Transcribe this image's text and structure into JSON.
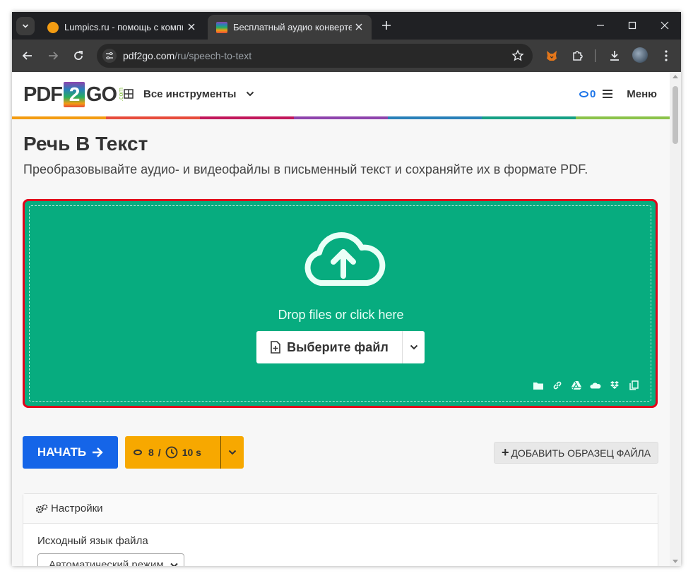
{
  "browser": {
    "tabs": [
      {
        "title": "Lumpics.ru - помощь с компьютером",
        "active": false,
        "favicon_color": "#f39c12"
      },
      {
        "title": "Бесплатный аудио конвертер онлайн",
        "active": true,
        "favicon_color": "#8e44ad"
      }
    ],
    "url_host": "pdf2go.com",
    "url_path": "/ru/speech-to-text"
  },
  "site": {
    "logo": {
      "pdf": "PDF",
      "two": "2",
      "go": "GO",
      "com": ".com"
    },
    "nav_tools": "Все инструменты",
    "credits": "0",
    "menu_label": "Меню",
    "rainbow_colors": [
      "#f39c12",
      "#e74c3c",
      "#c2185b",
      "#8e44ad",
      "#2980b9",
      "#16a085",
      "#8bc34a"
    ]
  },
  "page": {
    "title": "Речь В Текст",
    "subtitle": "Преобразовывайте аудио- и видеофайлы в письменный текст и сохраняйте их в формате PDF."
  },
  "dropzone": {
    "text": "Drop files or click here",
    "choose_button": "Выберите файл",
    "sources": [
      "folder-icon",
      "link-icon",
      "google-drive-icon",
      "onedrive-icon",
      "dropbox-icon",
      "clipboard-icon"
    ]
  },
  "actions": {
    "start": "НАЧАТЬ",
    "credits_cost": "8",
    "separator": "/",
    "time_cost": "10 s",
    "sample": "ДОБАВИТЬ ОБРАЗЕЦ ФАЙЛА"
  },
  "settings": {
    "heading": "Настройки",
    "language_label": "Исходный язык файла",
    "language_value": "Автоматический режим"
  },
  "colors": {
    "accent_green": "#07ac7f",
    "start_blue": "#1565e8",
    "cost_orange": "#f7a800",
    "highlight_red": "#e2001a"
  }
}
